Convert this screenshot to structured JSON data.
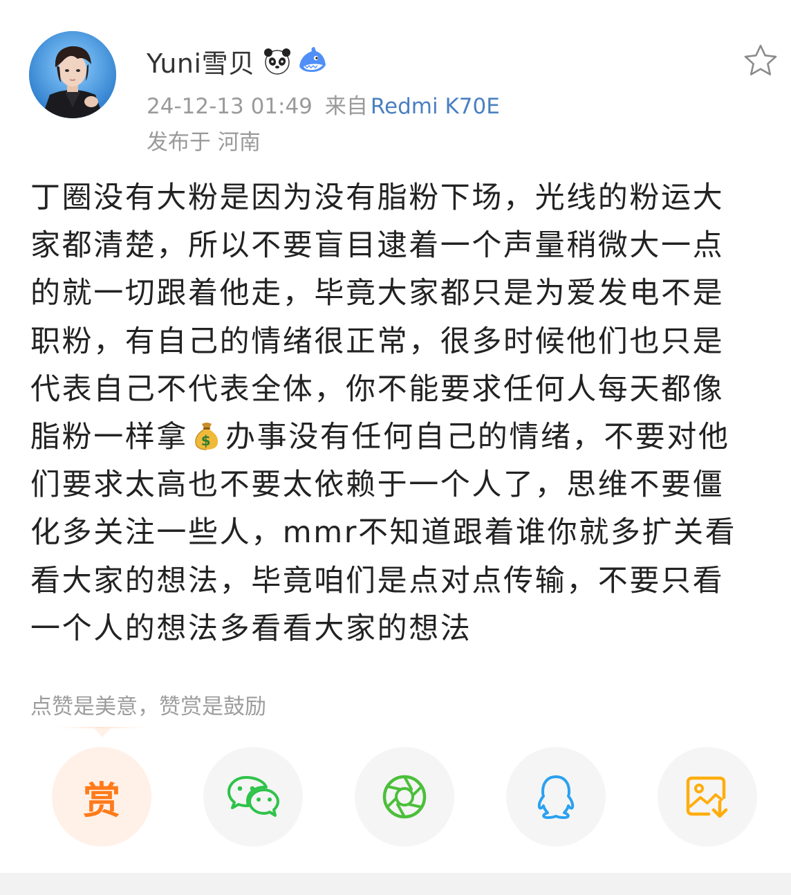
{
  "header": {
    "username": "Yuni雪贝",
    "badges": [
      "panda-badge-icon",
      "shark-badge-icon"
    ],
    "timestamp": "24-12-13 01:49",
    "from_label": "来自",
    "device": "Redmi K70E",
    "location": "发布于 河南",
    "favorite_icon": "star-outline-icon"
  },
  "post": {
    "lines": [
      "丁圈没有大粉是因为没有脂粉下场，光线的粉运大",
      "家都清楚，所以不要盲目逮着一个声量稍微大一点",
      "的就一切跟着他走，毕竟大家都只是为爱发电不是",
      "职粉，有自己的情绪很正常，很多时候他们也只是",
      "代表自己不代表全体，你不能要求任何人每天都像",
      "脂粉一样拿",
      "办事没有任何自己的情绪，不要对他",
      "们要求太高也不要太依赖于一个人了，思维不要僵",
      "化多关注一些人，mmr不知道跟着谁你就多扩关看",
      "看大家的想法，毕竟咱们是点对点传输，不要只看",
      "一个人的想法多看看大家的想法"
    ],
    "inline_emoji": "money-bag-icon"
  },
  "reward": {
    "hint": "点赞是美意，赞赏是鼓励",
    "button_label": "赏"
  },
  "share": {
    "wechat_icon": "wechat-icon",
    "moments_icon": "moments-icon",
    "qq_icon": "qq-icon",
    "save_image_icon": "save-image-icon"
  },
  "colors": {
    "accent_orange": "#ff7a1a",
    "wechat_green": "#2fc34a",
    "moments_green": "#4bbf3a",
    "qq_blue": "#2aa1f0",
    "save_orange": "#ffad0d",
    "device_link": "#4a7fc1",
    "meta_gray": "#9a9a9a"
  }
}
